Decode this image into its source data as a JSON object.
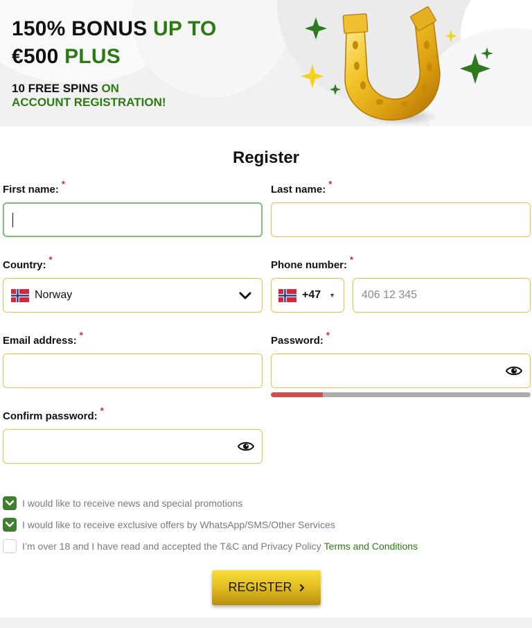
{
  "banner": {
    "line1_a": "150% BONUS",
    "line1_b": "UP TO",
    "line2_a": "€500",
    "line2_b": "PLUS",
    "spins_a": "10 FREE SPINS",
    "spins_b": "ON",
    "spins_c": "ACCOUNT REGISTRATION!",
    "accent_color": "#2c7a11"
  },
  "form": {
    "title": "Register",
    "required_mark": "*",
    "first_name": {
      "label": "First name:",
      "value": ""
    },
    "last_name": {
      "label": "Last name:",
      "value": ""
    },
    "country": {
      "label": "Country:",
      "selected": "Norway",
      "flag_icon": "norway-flag-icon"
    },
    "phone": {
      "label": "Phone number:",
      "code": "+47",
      "placeholder": "406 12 345"
    },
    "email": {
      "label": "Email address:",
      "value": ""
    },
    "password": {
      "label": "Password:",
      "value": "",
      "strength": 0.2
    },
    "confirm_password": {
      "label": "Confirm password:",
      "value": ""
    }
  },
  "checkboxes": [
    {
      "label": "I would like to receive news and special promotions",
      "checked": true
    },
    {
      "label": "I would like to receive exclusive offers by WhatsApp/SMS/Other Services",
      "checked": true
    },
    {
      "label": "I’m over 18 and I have read and accepted the T&C and Privacy Policy",
      "link": "Terms and Conditions",
      "checked": false
    }
  ],
  "register_button": {
    "label": "REGISTER"
  },
  "colors": {
    "border": "#e8c14a",
    "focus": "#8db884",
    "required": "#d02a2a",
    "checkbox": "#3f7f2f",
    "strength_weak": "#d64a4a"
  }
}
